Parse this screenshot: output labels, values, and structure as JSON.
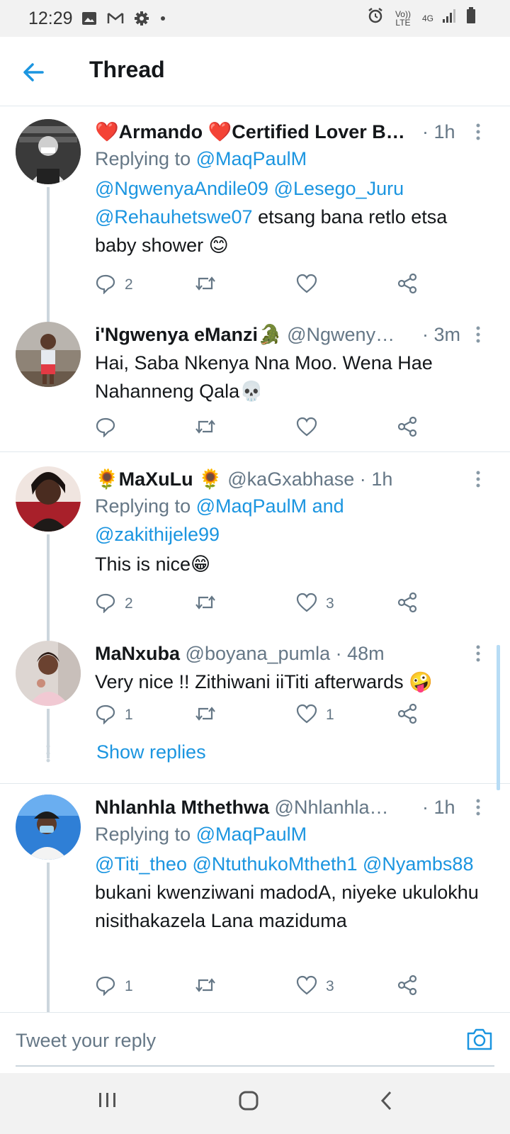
{
  "status_bar": {
    "time": "12:29",
    "volte": "Vo)) LTE",
    "network": "4G"
  },
  "app_bar": {
    "title": "Thread"
  },
  "tweets": [
    {
      "name_prefix": "❤️",
      "name": "Armando ❤️Certified Lover B…",
      "handle": "",
      "time": "1h",
      "replying_label": "Replying to",
      "replying_to": "@MaqPaulM",
      "mentions": "@NgwenyaAndile09 @Lesego_Juru @Rehauhetswe07",
      "text": " etsang bana retlo etsa baby shower 😊",
      "replies": "2",
      "retweets": "",
      "likes": ""
    },
    {
      "name_prefix": "",
      "name": "i'Ngwenya eManzi🐊",
      "handle": "@Ngweny…",
      "time": "3m",
      "text": "Hai, Saba Nkenya Nna Moo. Wena Hae Nahanneng Qala💀",
      "replies": "",
      "retweets": "",
      "likes": ""
    },
    {
      "name_prefix": "🌻",
      "name": "MaXuLu 🌻",
      "handle": "@kaGxabhase",
      "time": "1h",
      "replying_label": "Replying to",
      "replying_to": "@MaqPaulM and",
      "replying_to_2": "@zakithijele99",
      "text": "This is nice😁",
      "replies": "2",
      "retweets": "",
      "likes": "3"
    },
    {
      "name_prefix": "",
      "name": "MaNxuba",
      "handle": "@boyana_pumla",
      "time": "48m",
      "text": "Very nice !! Zithiwani iiTiti afterwards 🤪",
      "replies": "1",
      "retweets": "",
      "likes": "1",
      "show_replies": "Show replies"
    },
    {
      "name_prefix": "",
      "name": "Nhlanhla Mthethwa",
      "handle": "@Nhlanhla…",
      "time": "1h",
      "replying_label": "Replying to",
      "replying_to": "@MaqPaulM",
      "mentions": "@Titi_theo @NtuthukoMtheth1 @Nyambs88",
      "text": " bukani kwenziwani madodA, niyeke ukulokhu nisithakazela Lana maziduma",
      "replies": "1",
      "retweets": "",
      "likes": "3"
    }
  ],
  "reply_bar": {
    "placeholder": "Tweet your reply"
  },
  "colors": {
    "accent": "#1b95e0",
    "muted": "#657786",
    "text": "#14171a",
    "border": "#e1e8ed"
  }
}
